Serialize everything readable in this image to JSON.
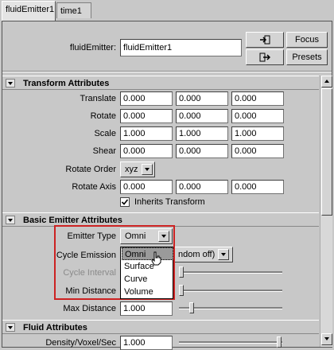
{
  "tabs": [
    {
      "label": "fluidEmitter1"
    },
    {
      "label": "time1"
    }
  ],
  "header": {
    "node_type_label": "fluidEmitter:",
    "node_name": "fluidEmitter1",
    "focus_label": "Focus",
    "presets_label": "Presets"
  },
  "transform": {
    "title": "Transform Attributes",
    "translate": {
      "label": "Translate",
      "values": [
        "0.000",
        "0.000",
        "0.000"
      ]
    },
    "rotate": {
      "label": "Rotate",
      "values": [
        "0.000",
        "0.000",
        "0.000"
      ]
    },
    "scale": {
      "label": "Scale",
      "values": [
        "1.000",
        "1.000",
        "1.000"
      ]
    },
    "shear": {
      "label": "Shear",
      "values": [
        "0.000",
        "0.000",
        "0.000"
      ]
    },
    "rotate_order": {
      "label": "Rotate Order",
      "value": "xyz"
    },
    "rotate_axis": {
      "label": "Rotate Axis",
      "values": [
        "0.000",
        "0.000",
        "0.000"
      ]
    },
    "inherits_label": "Inherits Transform",
    "inherits_checked": true
  },
  "emitter": {
    "title": "Basic Emitter Attributes",
    "type": {
      "label": "Emitter Type",
      "value": "Omni"
    },
    "cycle_emission": {
      "label": "Cycle Emission",
      "value": "(random off)",
      "visible_text": "ndom off)"
    },
    "cycle_interval": {
      "label": "Cycle Interval"
    },
    "min_distance": {
      "label": "Min Distance"
    },
    "max_distance": {
      "label": "Max Distance",
      "value": "1.000"
    },
    "menu": [
      "Omni",
      "Surface",
      "Curve",
      "Volume"
    ]
  },
  "fluid": {
    "title": "Fluid Attributes",
    "density": {
      "label": "Density/Voxel/Sec",
      "value": "1.000"
    }
  },
  "colors": {
    "highlight_box": "#cc2222",
    "selected_item": "#9a9a9a"
  }
}
